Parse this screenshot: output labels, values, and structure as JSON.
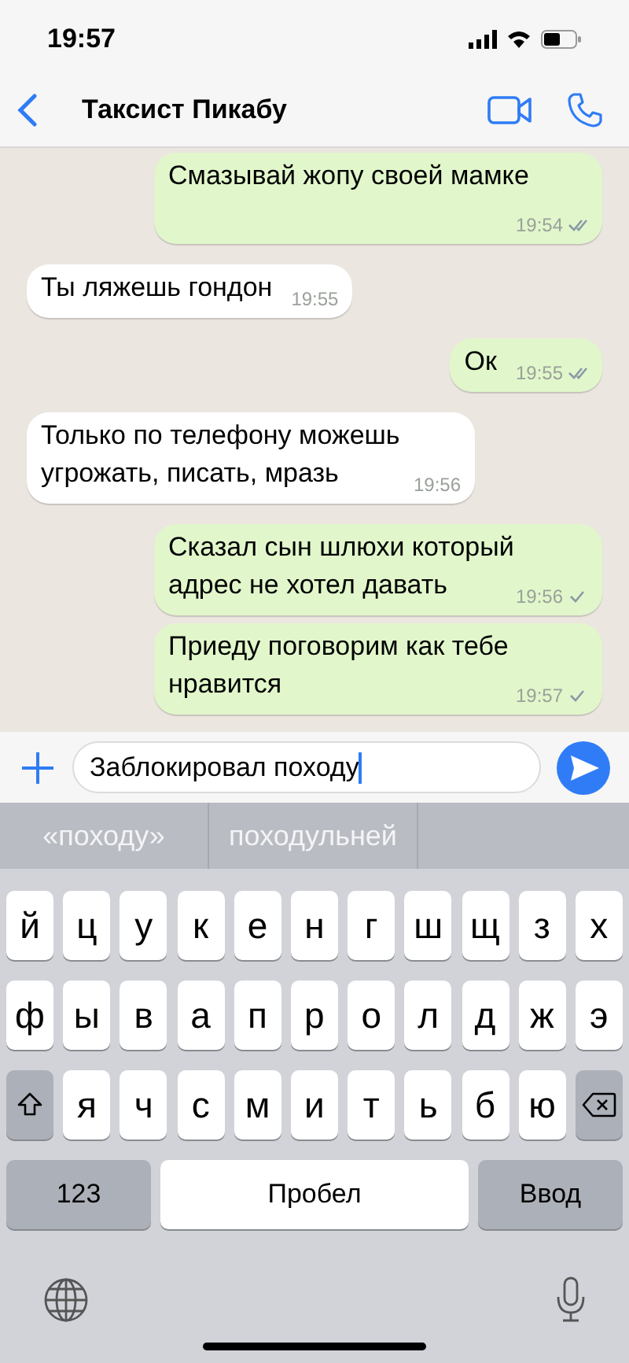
{
  "status_bar": {
    "time": "19:57"
  },
  "header": {
    "title": "Таксист Пикабу"
  },
  "messages": [
    {
      "outgoing": true,
      "text": "Смазывай жопу своей мамке",
      "time": "19:54",
      "delivered": true
    },
    {
      "outgoing": false,
      "text": "Ты ляжешь гондон",
      "time": "19:55"
    },
    {
      "outgoing": true,
      "text": "Ок",
      "time": "19:55",
      "delivered": true
    },
    {
      "outgoing": false,
      "text": "Только по телефону можешь угрожать, писать, мразь",
      "time": "19:56"
    },
    {
      "outgoing": true,
      "text": "Сказал сын шлюхи который адрес не хотел давать",
      "time": "19:56",
      "delivered": false
    },
    {
      "outgoing": true,
      "text": "Приеду поговорим как тебе нравится",
      "time": "19:57",
      "delivered": false
    }
  ],
  "composer": {
    "value": "Заблокировал походу"
  },
  "suggestions": [
    "«походу»",
    "походульней"
  ],
  "keyboard": {
    "top_row": [
      "й",
      "ц",
      "у",
      "к",
      "е",
      "н",
      "г",
      "ш",
      "щ",
      "з",
      "х"
    ],
    "middle_row": [
      "ф",
      "ы",
      "в",
      "а",
      "п",
      "р",
      "о",
      "л",
      "д",
      "ж",
      "э"
    ],
    "bottom_row": [
      "я",
      "ч",
      "с",
      "м",
      "и",
      "т",
      "ь",
      "б",
      "ю"
    ],
    "numbers_key": "123",
    "space_key": "Пробел",
    "return_key": "Ввод"
  }
}
